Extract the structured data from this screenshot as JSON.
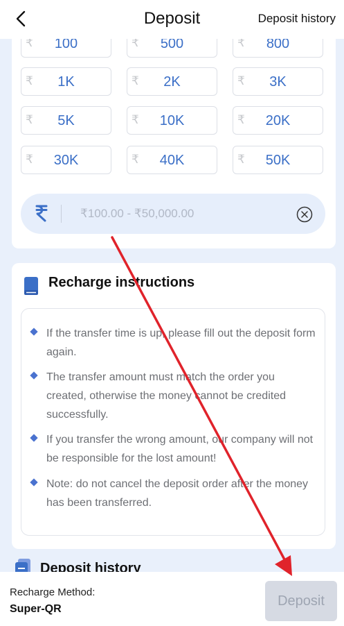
{
  "header": {
    "title": "Deposit",
    "history_link": "Deposit history",
    "back_icon": "chevron-left-icon"
  },
  "currency_symbol": "₹",
  "amounts": [
    "100",
    "500",
    "800",
    "1K",
    "2K",
    "3K",
    "5K",
    "10K",
    "20K",
    "30K",
    "40K",
    "50K"
  ],
  "amount_input": {
    "placeholder": "₹100.00 - ₹50,000.00",
    "icon": "rupee-icon",
    "clear_icon": "clear-circle-icon"
  },
  "instructions": {
    "title": "Recharge instructions",
    "items": [
      "If the transfer time is up, please fill out the deposit form again.",
      "The transfer amount must match the order you created, otherwise the money cannot be credited successfully.",
      "If you transfer the wrong amount, our company will not be responsible for the lost amount!",
      "Note: do not cancel the deposit order after the money has been transferred."
    ]
  },
  "history_section": {
    "title": "Deposit history"
  },
  "footer": {
    "recharge_method_label": "Recharge Method:",
    "recharge_method_value": "Super-QR",
    "deposit_button": "Deposit"
  },
  "colors": {
    "accent": "#3b6fc7",
    "page_bg": "#e9f0fb",
    "annotation_arrow": "#e0232b",
    "disabled_button": "#d6dae3"
  }
}
